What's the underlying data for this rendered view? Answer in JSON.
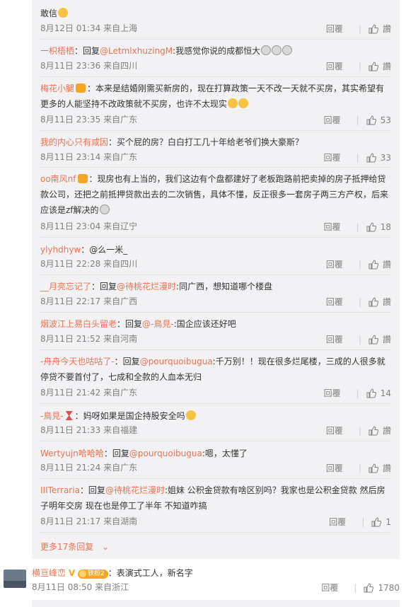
{
  "reply_label": "回覆",
  "like_label": "讚",
  "comments": [
    {
      "tail": "敢信",
      "time": "8月12日 01:34 来自上海",
      "likes": "讚"
    },
    {
      "user": "一枳梧栖",
      "prefix": "：回复",
      "mention": "@LetmlxhuzingM",
      "text": ":我感觉你说的成都恒大",
      "time": "8月11日 23:36 来自四川",
      "likes": "讚"
    },
    {
      "user": "梅花小腿",
      "text": "：本来是结婚刚需买新房的，现在打算政策一天不改一天就不买房，其实希望有更多的人能坚持不改政策就不买房，也许不太现实",
      "time": "8月11日 23:35 来自广东",
      "likes": "53"
    },
    {
      "user": "我的内心只有咸因",
      "text": "：买个屁的房？白白打工几十年给老爷们换大豪斯？",
      "time": "8月11日 23:14 来自广东",
      "likes": "33"
    },
    {
      "user": "oo南风nf",
      "text": "：现房也有上当的，我们这边有个盘都建好了老板跑路前把卖掉的房子抵押给贷款公司，还把之前抵押贷款出去的二次销售，具体不懂，反正很多一套房子两三方产权，后来应该是zf解决的",
      "time": "8月11日 23:04 来自辽宁",
      "likes": "18"
    },
    {
      "user": "ylyhdhyw",
      "text": "：@么一米_",
      "time": "8月11日 22:28 来自四川",
      "likes": "讚"
    },
    {
      "user": "__月亮忘记了",
      "prefix": "：回复",
      "mention": "@待桃花烂漫时",
      "text": ":同广西，想知道哪个楼盘",
      "time": "8月11日 22:17 来自广西",
      "likes": "讚"
    },
    {
      "user": "烟波江上易白头留老",
      "prefix": "：回复",
      "mention": "@-鳥見-",
      "text": ":国企应该还好吧",
      "time": "8月11日 21:52 来自河南",
      "likes": "讚"
    },
    {
      "user": "-舟舟今天也咕咕了-",
      "prefix": "：回复",
      "mention": "@pourquoibugua",
      "text": ":千万别！！现在很多烂尾楼，三成的人很多就停贷不要首付了，七成和全款的人血本无归",
      "time": "8月11日 21:42 来自广东",
      "likes": "14"
    },
    {
      "user": "-鳥見-",
      "text": "：妈呀如果是国企持股安全吗",
      "time": "8月11日 21:33 来自福建",
      "likes": "讚"
    },
    {
      "user": "Wertyujn哈哈哈",
      "prefix": "：回复",
      "mention": "@pourquoibugua",
      "text": ":嗯，太懂了",
      "time": "8月11日 21:24 来自广东",
      "likes": "讚"
    },
    {
      "user": "IIITerraria",
      "prefix": "：回复",
      "mention": "@待桃花烂漫时",
      "text": ":姐妹 公积金贷款有啥区别吗？我家也是公积金贷款 然后房子明年交房 现在也是停工了半年 不知道咋搞",
      "time": "8月11日 21:17 来自湖南",
      "likes": "1"
    }
  ],
  "more_replies": "更多17条回复",
  "main_comment": {
    "user": "横亘峰峦",
    "level": "铁粉2",
    "text": "：表演式工人，新名字",
    "time": "8月11日 08:50 来自浙江",
    "likes": "1780"
  }
}
